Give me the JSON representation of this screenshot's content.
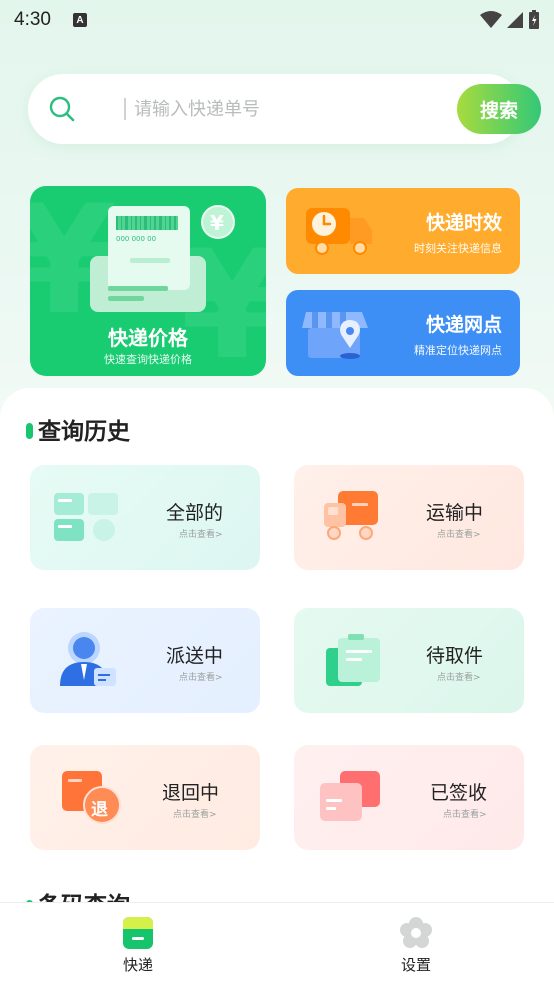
{
  "status_bar": {
    "time": "4:30",
    "notification_icon": "A"
  },
  "search": {
    "placeholder": "请输入快递单号",
    "button_label": "搜索"
  },
  "features": {
    "price": {
      "title": "快递价格",
      "subtitle": "快速查询快递价格",
      "receipt_number": "000 000 00",
      "currency_symbol": "¥"
    },
    "timing": {
      "title": "快递时效",
      "subtitle": "时刻关注快递信息"
    },
    "network": {
      "title": "快递网点",
      "subtitle": "精准定位快递网点"
    }
  },
  "history": {
    "title": "查询历史",
    "items": [
      {
        "label": "全部的",
        "hint": "点击查看>"
      },
      {
        "label": "运输中",
        "hint": "点击查看>"
      },
      {
        "label": "派送中",
        "hint": "点击查看>"
      },
      {
        "label": "待取件",
        "hint": "点击查看>"
      },
      {
        "label": "退回中",
        "hint": "点击查看>",
        "badge": "退"
      },
      {
        "label": "已签收",
        "hint": "点击查看>"
      }
    ]
  },
  "next_section": {
    "title": "条码查询"
  },
  "tab_bar": {
    "tabs": [
      {
        "label": "快递"
      },
      {
        "label": "设置"
      }
    ]
  },
  "colors": {
    "accent_green": "#19cc72",
    "timing_orange": "#ffac2e",
    "network_blue": "#3d8ef5"
  }
}
